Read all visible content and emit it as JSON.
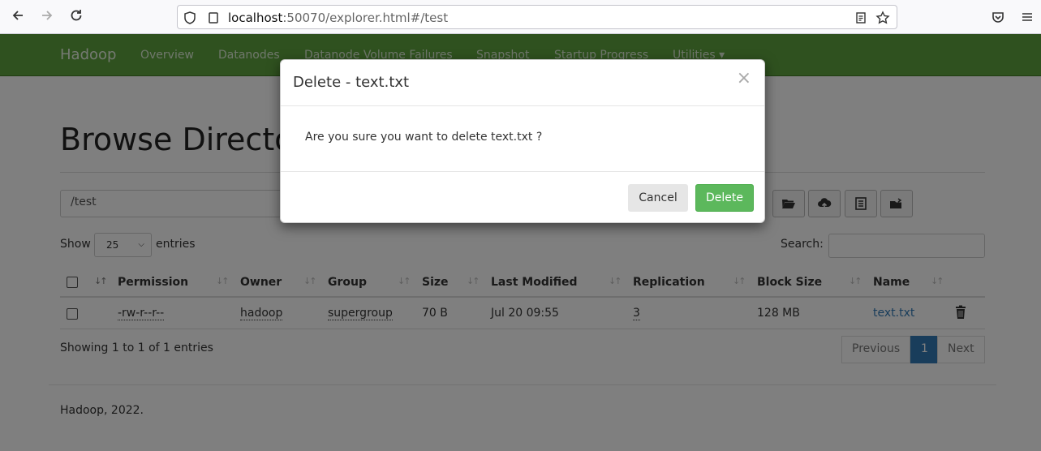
{
  "browser": {
    "url_host": "localhost",
    "url_rest": ":50070/explorer.html#/test"
  },
  "navbar": {
    "brand": "Hadoop",
    "links": [
      "Overview",
      "Datanodes",
      "Datanode Volume Failures",
      "Snapshot",
      "Startup Progress",
      "Utilities ▾"
    ]
  },
  "main": {
    "title": "Browse Directory",
    "path_value": "/test",
    "show_label": "Show",
    "page_size": "25",
    "entries_label": "entries",
    "search_label": "Search:",
    "columns": [
      "Permission",
      "Owner",
      "Group",
      "Size",
      "Last Modified",
      "Replication",
      "Block Size",
      "Name"
    ],
    "rows": [
      {
        "permission": "-rw-r--r--",
        "owner": "hadoop",
        "group": "supergroup",
        "size": "70 B",
        "last_modified": "Jul 20 09:55",
        "replication": "3",
        "block_size": "128 MB",
        "name": "text.txt"
      }
    ],
    "showing": "Showing 1 to 1 of 1 entries",
    "pagination": {
      "previous": "Previous",
      "current": "1",
      "next": "Next"
    }
  },
  "footer": {
    "text": "Hadoop, 2022."
  },
  "modal": {
    "title": "Delete - text.txt",
    "close": "×",
    "message": "Are you sure you want to delete text.txt ?",
    "cancel_label": "Cancel",
    "delete_label": "Delete"
  },
  "colors": {
    "navbar": "#5fa33e",
    "delete_button": "#5cb85c",
    "link": "#337ab7"
  }
}
